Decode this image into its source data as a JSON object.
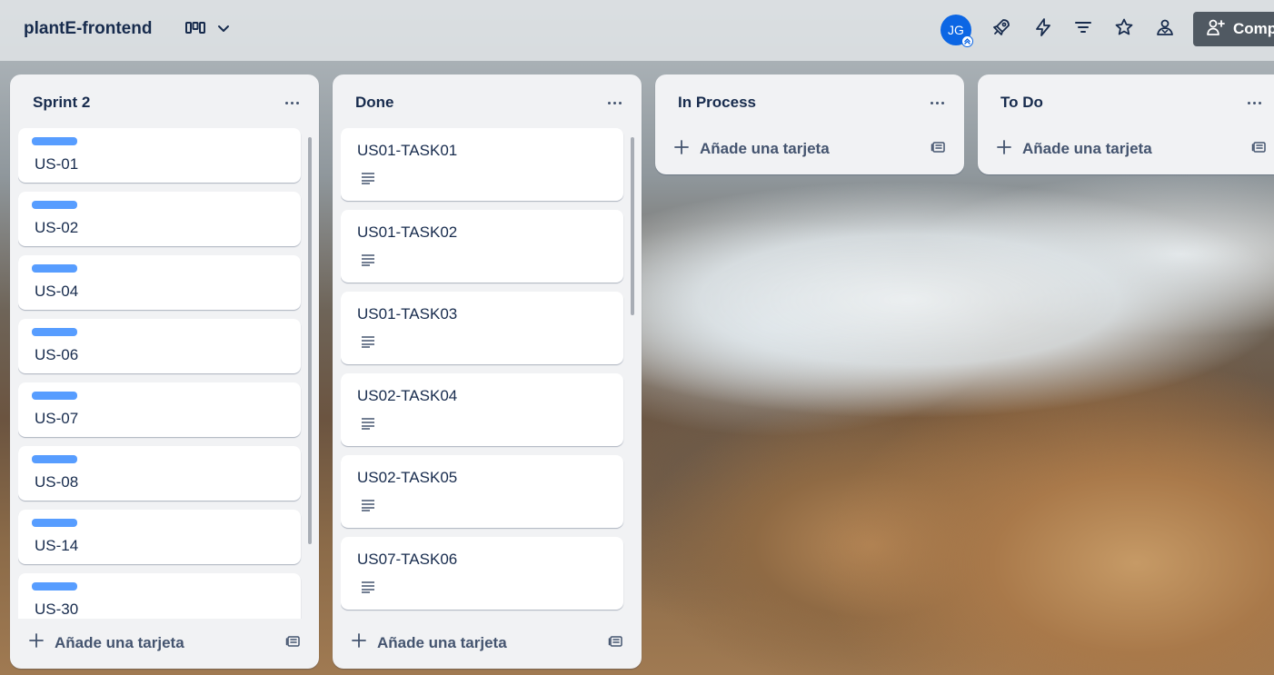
{
  "header": {
    "board_title": "plantE-frontend",
    "avatar_initials": "JG",
    "share_label": "Comp",
    "icons": [
      "board-view-icon",
      "chevron-down-icon",
      "power-ups-icon",
      "automation-icon",
      "filter-icon",
      "star-icon",
      "visibility-icon",
      "add-member-icon"
    ]
  },
  "lists": [
    {
      "title": "Sprint 2",
      "cards": [
        {
          "title": "US-01"
        },
        {
          "title": "US-02"
        },
        {
          "title": "US-04"
        },
        {
          "title": "US-06"
        },
        {
          "title": "US-07"
        },
        {
          "title": "US-08"
        },
        {
          "title": "US-14"
        },
        {
          "title": "US-30"
        }
      ],
      "add_card_label": "Añade una tarjeta"
    },
    {
      "title": "Done",
      "cards": [
        {
          "title": "US01-TASK01"
        },
        {
          "title": "US01-TASK02"
        },
        {
          "title": "US01-TASK03"
        },
        {
          "title": "US02-TASK04"
        },
        {
          "title": "US02-TASK05"
        },
        {
          "title": "US07-TASK06"
        }
      ],
      "add_card_label": "Añade una tarjeta"
    },
    {
      "title": "In Process",
      "cards": [],
      "add_card_label": "Añade una tarjeta"
    },
    {
      "title": "To Do",
      "cards": [],
      "add_card_label": "Añade una tarjeta"
    }
  ],
  "colors": {
    "label_blue": "#579dff",
    "avatar_blue": "#0c66e4",
    "text_dark": "#172b4d",
    "list_bg": "#f1f2f4"
  }
}
